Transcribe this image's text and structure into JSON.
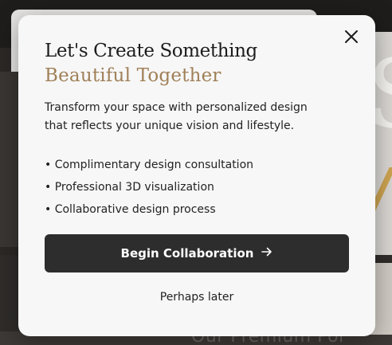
{
  "modal": {
    "title_line1": "Let's Create Something",
    "title_line2": "Beautiful Together",
    "description": "Transform your space with personalized design that reflects your unique vision and lifestyle.",
    "features": [
      "• Complimentary design consultation",
      "• Professional 3D visualization",
      "• Collaborative design process"
    ],
    "primary_button": "Begin Collaboration",
    "secondary_button": "Perhaps later",
    "close_icon": "close-icon",
    "arrow_icon": "arrow-right-icon"
  },
  "background": {
    "visible_text": "Our Premium Por"
  },
  "colors": {
    "accent_gold": "#a08058",
    "button_dark": "#2d2d2d",
    "modal_bg": "#f7f7f7"
  }
}
